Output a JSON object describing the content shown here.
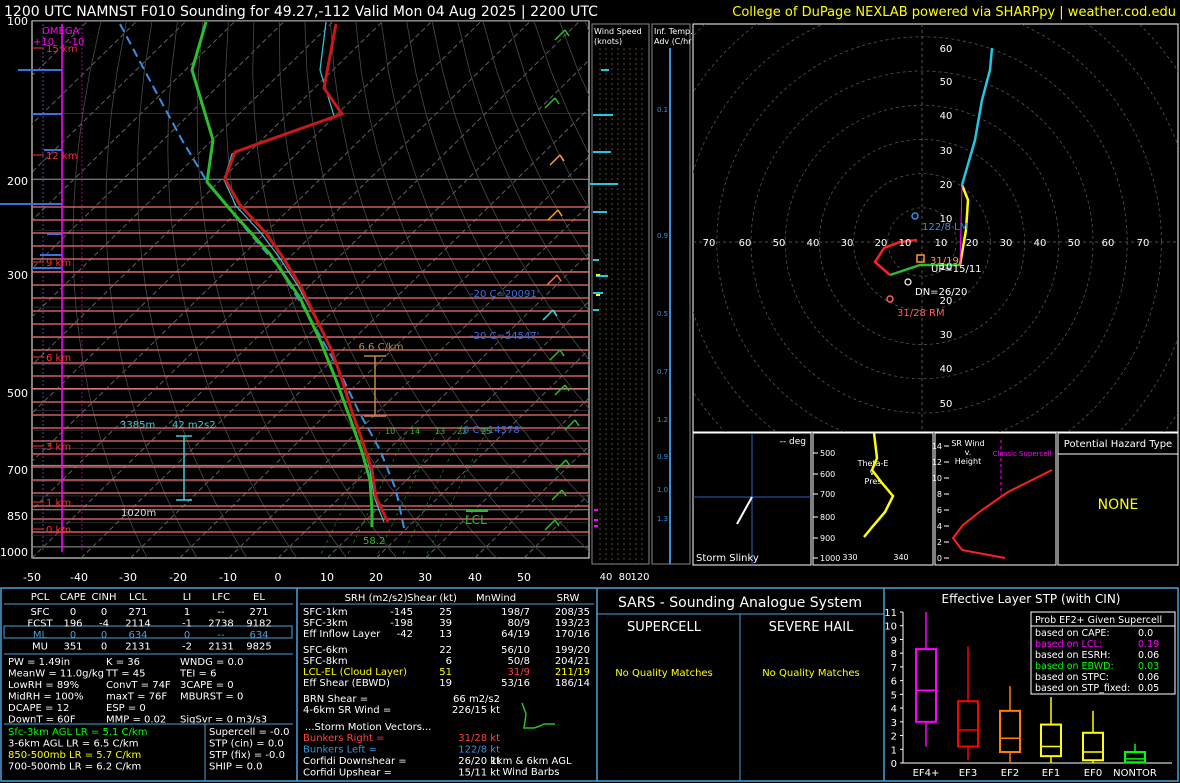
{
  "header": {
    "title": "1200 UTC NAMNST F010 Sounding for 49.27,-112 Valid  Mon 04 Aug 2025 | 2200 UTC",
    "credit": "College of DuPage NEXLAB powered via SHARPpy | weather.cod.edu"
  },
  "skewt": {
    "pressure_ticks": [
      "100",
      "200",
      "300",
      "500",
      "700",
      "850",
      "1000"
    ],
    "temp_ticks": [
      "-50",
      "-40",
      "-30",
      "-20",
      "-10",
      "0",
      "10",
      "20",
      "30",
      "40",
      "50"
    ],
    "height_labels": [
      "15 km",
      "12 km",
      "9 km",
      "6 km",
      "3 km",
      "1 km",
      "0 km"
    ],
    "omega_title": "OMEGA",
    "omega_scale": [
      "+10",
      "-10"
    ],
    "annotations": {
      "lapse": "6.6 C/km",
      "dgz": "3385m",
      "srh": "42 m2s2",
      "lcl": "LCL",
      "sfc": "58.2",
      "lower": "1020m",
      "hgt_m20": "-20 C=20091'",
      "hgt_m20b": "-20 C=24547'",
      "hgt_0": "0 C=14378'"
    },
    "mixing_ratio_labels": [
      "10",
      "14",
      "13",
      "22",
      "25"
    ]
  },
  "wind_panel": {
    "speed_title": "Wind Speed",
    "speed_units": "(knots)",
    "speed_ticks": [
      "40",
      "80",
      "120"
    ],
    "adv_title": "Inf. Temp.",
    "adv_units": "Adv (C/hr)",
    "adv_values": [
      "0.1",
      "0.9",
      "0.5",
      "0.7",
      "1.2",
      "0.9",
      "1.0",
      "1.3"
    ]
  },
  "hodograph": {
    "x_ticks": [
      "70",
      "60",
      "50",
      "40",
      "30",
      "20",
      "10",
      "10",
      "20",
      "30",
      "40",
      "50",
      "60",
      "70"
    ],
    "y_ticks": [
      "60",
      "50",
      "40",
      "30",
      "20",
      "10",
      "10",
      "20",
      "30",
      "40",
      "50",
      "60"
    ],
    "labels": {
      "lm": "122/8 LM",
      "rm": "31/28 RM",
      "up": "UP=15/11",
      "dn": "DN=26/20",
      "mean": "31/19"
    }
  },
  "slinky": {
    "title": "Storm Slinky",
    "deg": "-- deg"
  },
  "thetae": {
    "title": [
      "Theta-E",
      "v.",
      "Pres"
    ],
    "x_ticks": [
      "330",
      "340"
    ],
    "p_ticks": [
      "500",
      "600",
      "700",
      "800",
      "900",
      "1000"
    ]
  },
  "srwind": {
    "title": [
      "SR Wind",
      "v.",
      "Height"
    ],
    "y_ticks": [
      "14",
      "12",
      "10",
      "8",
      "6",
      "4",
      "2",
      "0"
    ],
    "classic": "Classic Supercell"
  },
  "hazard": {
    "title": "Potential Hazard Type",
    "value": "NONE"
  },
  "parcels": {
    "headers": [
      "PCL",
      "CAPE",
      "CINH",
      "LCL",
      "LI",
      "LFC",
      "EL"
    ],
    "rows": [
      [
        "SFC",
        "0",
        "0",
        "271",
        "1",
        "--",
        "271"
      ],
      [
        "FCST",
        "196",
        "-4",
        "2114",
        "-1",
        "2738",
        "9182"
      ],
      [
        "ML",
        "0",
        "0",
        "634",
        "0",
        "--",
        "634"
      ],
      [
        "MU",
        "351",
        "0",
        "2131",
        "-2",
        "2131",
        "9825"
      ]
    ]
  },
  "indices": {
    "col1": [
      "PW = 1.49in",
      "MeanW = 11.0g/kg",
      "LowRH = 89%",
      "MidRH = 100%",
      "DCAPE = 12",
      "DownT = 60F"
    ],
    "col2": [
      "K = 36",
      "TT = 45",
      "ConvT = 74F",
      "maxT = 76F",
      "ESP = 0",
      "MMP = 0.02"
    ],
    "col3": [
      "WNDG = 0.0",
      "TEI = 6",
      "3CAPE = 0",
      "MBURST = 0",
      "",
      "SigSvr = 0 m3/s3"
    ]
  },
  "lapse_rates": [
    {
      "text": "Sfc-3km AGL LR = 5.1 C/km",
      "color": "#00ff00"
    },
    {
      "text": "3-6km AGL LR = 6.5 C/km",
      "color": "#ffffff"
    },
    {
      "text": "850-500mb LR = 5.7 C/km",
      "color": "#ffff00"
    },
    {
      "text": "700-500mb LR = 6.2 C/km",
      "color": "#ffffff"
    }
  ],
  "composites": [
    "Supercell = -0.0",
    "STP (cin) = 0.0",
    "STP (fix) = -0.0",
    "SHIP = 0.0"
  ],
  "kinematics": {
    "headers": [
      "SRH (m2/s2)",
      "Shear (kt)",
      "MnWind",
      "SRW"
    ],
    "rows": [
      {
        "label": "SFC-1km",
        "srh": "-145",
        "shear": "25",
        "mn": "198/7",
        "srw": "208/35",
        "color": "#ffffff"
      },
      {
        "label": "SFC-3km",
        "srh": "-198",
        "shear": "39",
        "mn": "80/9",
        "srw": "193/23",
        "color": "#ffffff"
      },
      {
        "label": "Eff Inflow Layer",
        "srh": "-42",
        "shear": "13",
        "mn": "64/19",
        "srw": "170/16",
        "color": "#ffffff"
      },
      {
        "label": "SFC-6km",
        "srh": "",
        "shear": "22",
        "mn": "56/10",
        "srw": "199/20",
        "color": "#ffffff"
      },
      {
        "label": "SFC-8km",
        "srh": "",
        "shear": "6",
        "mn": "50/8",
        "srw": "204/21",
        "color": "#ffffff"
      },
      {
        "label": "LCL-EL (Cloud Layer)",
        "srh": "",
        "shear": "51",
        "mn": "31/9",
        "srw": "211/19",
        "color": "#ffff00"
      },
      {
        "label": "Eff Shear (EBWD)",
        "srh": "",
        "shear": "19",
        "mn": "53/16",
        "srw": "186/14",
        "color": "#ffffff"
      }
    ],
    "brn": "BRN Shear =",
    "brn_val": "66 m2/s2",
    "sr46": "4-6km SR Wind =",
    "sr46_val": "226/15 kt",
    "storm_title": "...Storm Motion Vectors...",
    "bunkers_right": "Bunkers Right =",
    "bunkers_right_val": "31/28 kt",
    "bunkers_left": "Bunkers Left =",
    "bunkers_left_val": "122/8 kt",
    "corfidi_down": "Corfidi Downshear =",
    "corfidi_down_val": "26/20 kt",
    "corfidi_up": "Corfidi Upshear =",
    "corfidi_up_val": "15/11 kt",
    "barb_caption": [
      "1km & 6km AGL",
      "Wind Barbs"
    ]
  },
  "sars": {
    "title": "SARS - Sounding Analogue System",
    "supercell": "SUPERCELL",
    "hail": "SEVERE HAIL",
    "no_match": "No Quality Matches"
  },
  "stp": {
    "title": "Effective Layer STP (with CIN)",
    "box_title": "Prob EF2+ Given Supercell",
    "probs": [
      {
        "label": "based on CAPE:",
        "val": "0.0",
        "color": "#ffffff"
      },
      {
        "label": "based on LCL:",
        "val": "0.19",
        "color": "#ff00ff"
      },
      {
        "label": "based on ESRH:",
        "val": "0.06",
        "color": "#ffffff"
      },
      {
        "label": "based on EBWD:",
        "val": "0.03",
        "color": "#00ff00"
      },
      {
        "label": "based on STPC:",
        "val": "0.06",
        "color": "#ffffff"
      },
      {
        "label": "based on STP_fixed:",
        "val": "0.05",
        "color": "#ffffff"
      }
    ],
    "y_ticks": [
      "11",
      "10",
      "9",
      "8",
      "7",
      "6",
      "5",
      "4",
      "3",
      "2",
      "1",
      "0"
    ],
    "categories": [
      "EF4+",
      "EF3",
      "EF2",
      "EF1",
      "EF0",
      "NONTOR"
    ]
  },
  "chart_data": {
    "type": "box",
    "title": "Effective Layer STP (with CIN)",
    "categories": [
      "EF4+",
      "EF3",
      "EF2",
      "EF1",
      "EF0",
      "NONTOR"
    ],
    "ylim": [
      0,
      11
    ],
    "boxes": [
      {
        "name": "EF4+",
        "low": 1.2,
        "q1": 3.0,
        "median": 5.3,
        "q3": 8.3,
        "high": 11.0,
        "color": "#ff00ff"
      },
      {
        "name": "EF3",
        "low": 0.2,
        "q1": 1.2,
        "median": 2.4,
        "q3": 4.5,
        "high": 8.5,
        "color": "#ff0000"
      },
      {
        "name": "EF2",
        "low": 0.0,
        "q1": 0.8,
        "median": 1.8,
        "q3": 3.8,
        "high": 5.6,
        "color": "#ff8000"
      },
      {
        "name": "EF1",
        "low": 0.0,
        "q1": 0.5,
        "median": 1.2,
        "q3": 2.8,
        "high": 4.8,
        "color": "#ffff00"
      },
      {
        "name": "EF0",
        "low": 0.0,
        "q1": 0.2,
        "median": 0.8,
        "q3": 2.2,
        "high": 3.8,
        "color": "#ffff00"
      },
      {
        "name": "NONTOR",
        "low": 0.0,
        "q1": 0.05,
        "median": 0.3,
        "q3": 0.8,
        "high": 1.4,
        "color": "#00ff00"
      }
    ]
  }
}
